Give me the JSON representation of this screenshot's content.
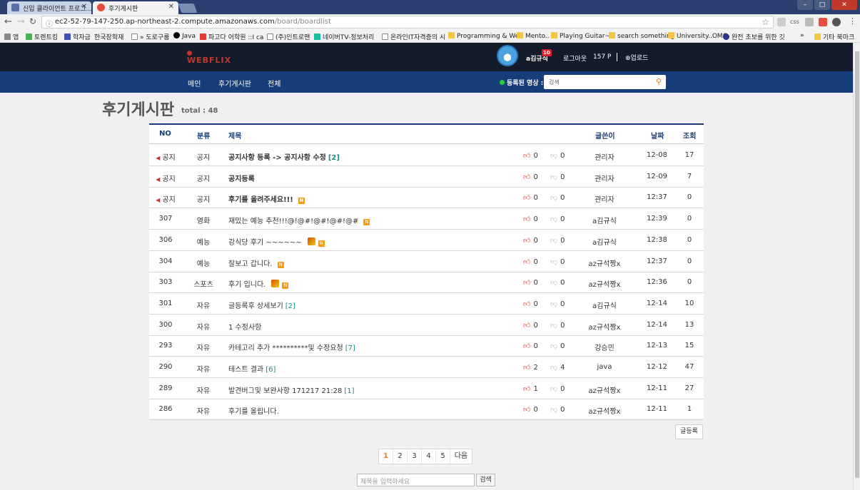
{
  "browser": {
    "tabs": [
      {
        "label": "신입 클라이언트 프로그..."
      },
      {
        "label": "후기게시판"
      }
    ],
    "url_host": "ec2-52-79-147-250.ap-northeast-2.compute.amazonaws.com",
    "url_path": "/board/boardlist",
    "bookmarks": [
      "앱",
      "토렌트킹",
      "학자금",
      "한국장학재",
      "» 도로구룹",
      "Java",
      "파고다 어학원 ::I ca",
      "(주)인트로맨",
      "네이버TV-정보처리",
      "온라인IT자격증의 시",
      "Programming & We",
      "Mento..",
      "Playing Guitar~♪",
      "search something",
      "University..OMG",
      "완전 초보를 위한 깃",
      "»",
      "기타 북마크"
    ],
    "extensions": [
      "css"
    ]
  },
  "site": {
    "logo": "WEBFLIX",
    "user": {
      "name": "a김규식",
      "badge": "10",
      "logout": "로그아웃",
      "points": "157 P",
      "upload": "업로드"
    },
    "nav": [
      "메인",
      "후기게시판",
      "전체"
    ],
    "registered_label": "등록된 영상 :",
    "search_placeholder": "검색"
  },
  "board": {
    "title": "후기게시판",
    "total": "total : 48",
    "columns": [
      "NO",
      "분류",
      "제목",
      "글쓴이",
      "날짜",
      "조회"
    ],
    "rows": [
      {
        "no": "공지",
        "cat": "공지",
        "title": "공지사항 등록 -> 공지사항 수정",
        "comments": "[2]",
        "likes": "0",
        "dislikes": "0",
        "author": "관리자",
        "date": "12-08",
        "views": "17"
      },
      {
        "no": "공지",
        "cat": "공지",
        "title": "공지등록",
        "comments": "",
        "likes": "0",
        "dislikes": "0",
        "author": "관리자",
        "date": "12-09",
        "views": "7"
      },
      {
        "no": "공지",
        "cat": "공지",
        "title": "후기를 올려주세요!!!",
        "comments": "",
        "likes": "0",
        "dislikes": "0",
        "author": "관리자",
        "date": "12:37",
        "views": "0"
      },
      {
        "no": "307",
        "cat": "영화",
        "title": "재밌는 예능 추천!!!@!@#!@#!@#!@#",
        "comments": "",
        "likes": "0",
        "dislikes": "0",
        "author": "a김규식",
        "date": "12:39",
        "views": "0"
      },
      {
        "no": "306",
        "cat": "예능",
        "title": "강식당 후기 ~~~~~~",
        "comments": "",
        "likes": "0",
        "dislikes": "0",
        "author": "a김규식",
        "date": "12:38",
        "views": "0"
      },
      {
        "no": "304",
        "cat": "예능",
        "title": "잘보고 갑니다.",
        "comments": "",
        "likes": "0",
        "dislikes": "0",
        "author": "az규석짱x",
        "date": "12:37",
        "views": "0"
      },
      {
        "no": "303",
        "cat": "스포츠",
        "title": "후기 입니다.",
        "comments": "",
        "likes": "0",
        "dislikes": "0",
        "author": "az규석짱x",
        "date": "12:36",
        "views": "0"
      },
      {
        "no": "301",
        "cat": "자유",
        "title": "글등록후 상세보기",
        "comments": "[2]",
        "likes": "0",
        "dislikes": "0",
        "author": "a김규식",
        "date": "12-14",
        "views": "10"
      },
      {
        "no": "300",
        "cat": "자유",
        "title": "1 수정사항",
        "comments": "",
        "likes": "0",
        "dislikes": "0",
        "author": "az규석짱x",
        "date": "12-14",
        "views": "13"
      },
      {
        "no": "293",
        "cat": "자유",
        "title": "카테고리 추가 **********및 수정요청",
        "comments": "[7]",
        "likes": "0",
        "dislikes": "0",
        "author": "강승민",
        "date": "12-13",
        "views": "15"
      },
      {
        "no": "290",
        "cat": "자유",
        "title": "테스트 결과",
        "comments": "[6]",
        "likes": "2",
        "dislikes": "4",
        "author": "java",
        "date": "12-12",
        "views": "47"
      },
      {
        "no": "289",
        "cat": "자유",
        "title": "발견버그및 보완사항 171217 21:28",
        "comments": "[1]",
        "likes": "1",
        "dislikes": "0",
        "author": "az규석짱x",
        "date": "12-11",
        "views": "27"
      },
      {
        "no": "286",
        "cat": "자유",
        "title": "후기를 올립니다.",
        "comments": "",
        "likes": "0",
        "dislikes": "0",
        "author": "az규석짱x",
        "date": "12-11",
        "views": "1"
      }
    ],
    "new_badge": "N",
    "write_button": "글등록",
    "pages": [
      "1",
      "2",
      "3",
      "4",
      "5"
    ],
    "next_label": "다음",
    "bottom_search_placeholder": "제목을 입력하세요",
    "bottom_search_button": "검색"
  }
}
